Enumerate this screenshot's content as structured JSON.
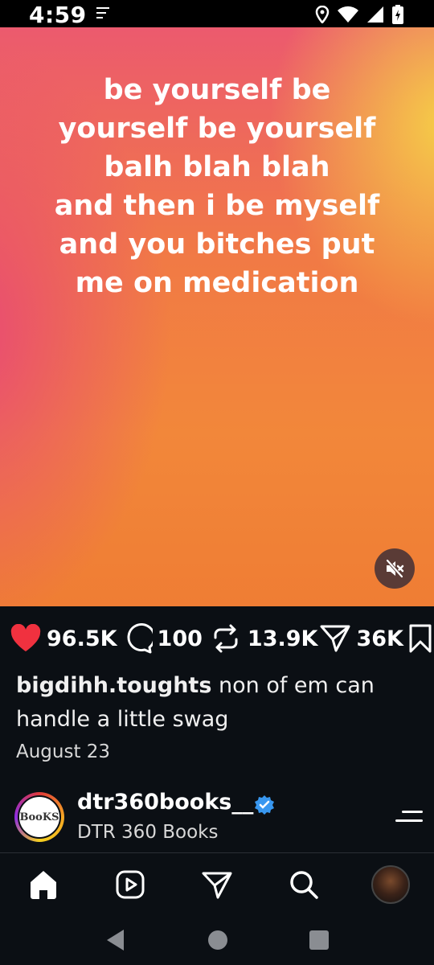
{
  "status_bar": {
    "time": "4:59",
    "icons": [
      "notification-menu-icon",
      "location-icon",
      "wifi-icon",
      "signal-icon",
      "battery-charging-icon"
    ]
  },
  "post": {
    "overlay_text": "be yourself be\nyourself be yourself\nbalh blah blah\nand then i be myself\nand you bitches put\nme on medication",
    "mute_icon": "speaker-muted-icon",
    "likes": "96.5K",
    "comments": "100",
    "reposts": "13.9K",
    "shares": "36K",
    "caption_user": "bigdihh.toughts",
    "caption_text": " non of em can handle a little swag",
    "date": "August 23"
  },
  "suggested_account": {
    "avatar_text": "BooKS",
    "handle": "dtr360books__",
    "name": "DTR 360 Books"
  },
  "colors": {
    "heart": "#f0313f",
    "verified": "#3897f0",
    "background": "#0b0f14"
  },
  "bottom_nav": [
    "home-icon",
    "reels-icon",
    "direct-message-icon",
    "search-icon",
    "profile-avatar"
  ],
  "system_nav": [
    "back-icon",
    "home-circle-icon",
    "recents-icon"
  ]
}
